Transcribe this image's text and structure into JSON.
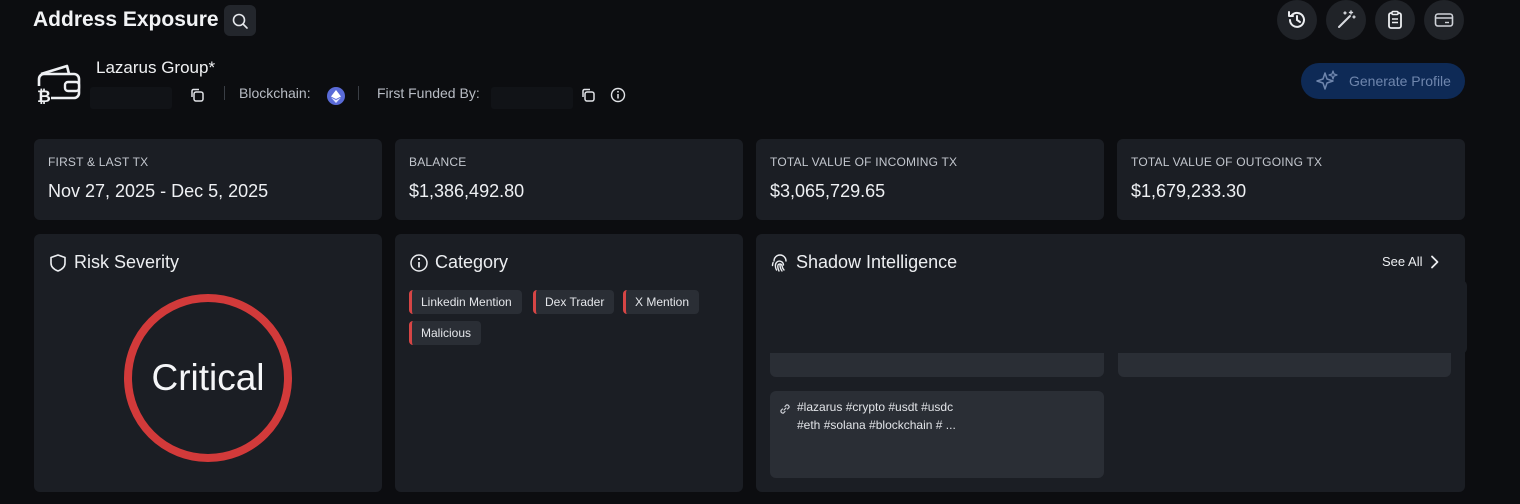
{
  "header": {
    "title": "Address Exposure",
    "icons": [
      "search-icon",
      "history-icon",
      "magic-wand-icon",
      "clipboard-icon",
      "card-icon"
    ]
  },
  "entity": {
    "name": "Lazarus Group*",
    "blockchain_label": "Blockchain:",
    "first_funded_label": "First Funded By:",
    "separator": "|",
    "generate_button": "Generate Profile"
  },
  "stats": [
    {
      "label": "FIRST & LAST TX",
      "value": "Nov 27, 2025 - Dec 5, 2025"
    },
    {
      "label": "BALANCE",
      "value": "$1,386,492.80"
    },
    {
      "label": "TOTAL VALUE OF INCOMING TX",
      "value": "$3,065,729.65"
    },
    {
      "label": "TOTAL VALUE OF OUTGOING TX",
      "value": "$1,679,233.30"
    }
  ],
  "risk": {
    "title": "Risk Severity",
    "level": "Critical",
    "color": "#d23a3a"
  },
  "category": {
    "title": "Category",
    "tags": [
      "Linkedin Mention",
      "Dex Trader",
      "X Mention",
      "Malicious"
    ]
  },
  "intel": {
    "title": "Shadow Intelligence",
    "see_all": "See All",
    "post_line1": "#lazarus #crypto #usdt #usdc",
    "post_line2": "#eth #solana #blockchain # ..."
  },
  "colors": {
    "accent_red": "#d64545",
    "button_blue": "#0e2a56",
    "eth": "#5a6bd8"
  }
}
